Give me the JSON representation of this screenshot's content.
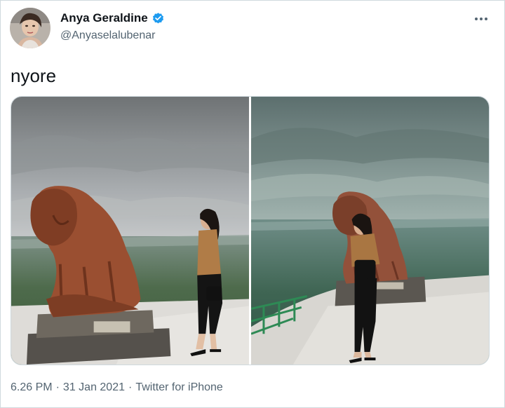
{
  "author": {
    "display_name": "Anya Geraldine",
    "handle": "@Anyaselalubenar",
    "verified": true,
    "avatar_icon": "profile-photo"
  },
  "tweet": {
    "text": "nyore",
    "photos": [
      {
        "alt": "Woman standing beside a lion statue on a hilltop viewpoint"
      },
      {
        "alt": "Woman standing in front of a lion statue overlooking the valley"
      }
    ]
  },
  "meta": {
    "time": "6.26 PM",
    "separator": "·",
    "date": "31 Jan 2021",
    "source": "Twitter for iPhone"
  },
  "colors": {
    "accent": "#1d9bf0",
    "muted": "#536471",
    "text": "#0f1419"
  }
}
